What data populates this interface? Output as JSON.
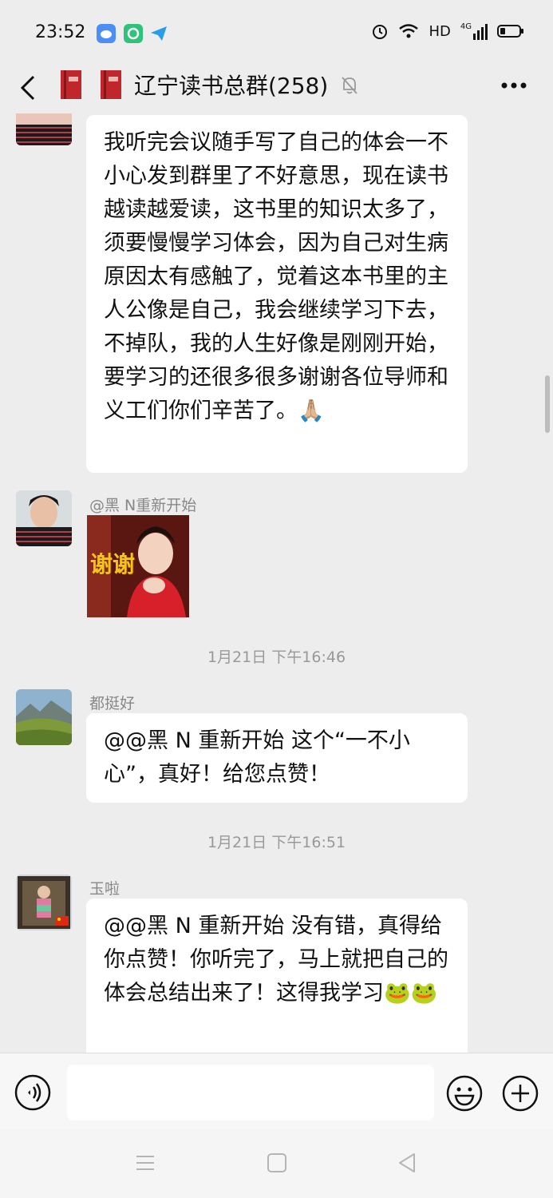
{
  "status_bar": {
    "time": "23:52",
    "network": "HD",
    "signal": "4G"
  },
  "header": {
    "title": "辽宁读书总群(258)"
  },
  "messages": {
    "m1": "我听完会议随手写了自己的体会一不小心发到群里了不好意思，现在读书越读越爱读，这书里的知识太多了，须要慢慢学习体会，因为自己对生病原因太有感触了，觉着这本书里的主人公像是自己，我会继续学习下去，不掉队，我的人生好像是刚刚开始，要学习的还很多很多谢谢各位导师和义工们你们辛苦了。🙏🏼",
    "m2_sender": "@黑 N重新开始",
    "m2_sticker_text": "谢谢",
    "ts1": "1月21日 下午16:46",
    "m3_sender": "都挺好",
    "m3": "@@黑 N 重新开始  这个“一不小心”，真好！给您点赞！",
    "ts2": "1月21日 下午16:51",
    "m4_sender": "玉啦",
    "m4": "@@黑 N 重新开始  没有错，真得给你点赞！你听完了，马上就把自己的体会总结出来了！这得我学习🐸🐸"
  },
  "colors": {
    "background": "#ededed",
    "bubble": "#ffffff",
    "meta_text": "#999999"
  }
}
